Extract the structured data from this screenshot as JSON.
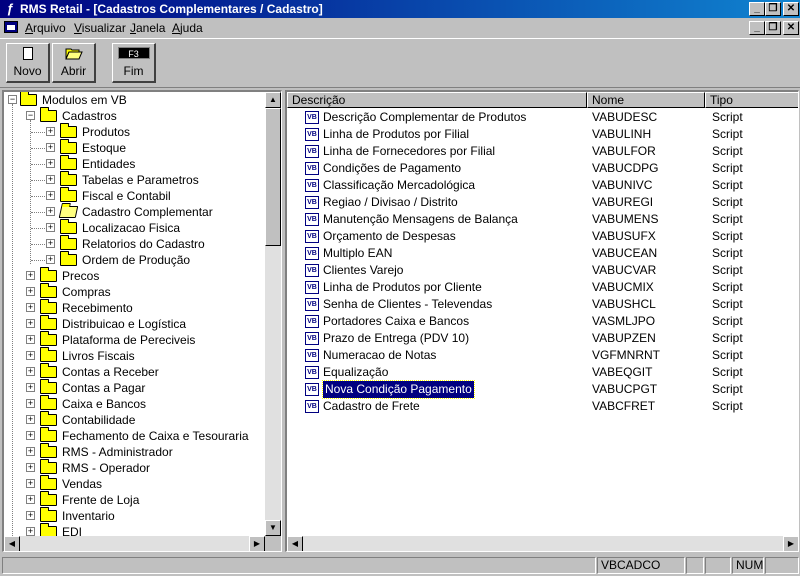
{
  "window": {
    "title": "RMS Retail - [Cadastros Complementares / Cadastro]"
  },
  "menu": [
    "Arquivo",
    "Visualizar",
    "Janela",
    "Ajuda"
  ],
  "toolbar": {
    "novo": "Novo",
    "abrir": "Abrir",
    "fim": "Fim",
    "fim_key": "F3"
  },
  "tree": {
    "root": "Modulos em VB",
    "cadastros": "Cadastros",
    "cadastros_children": [
      "Produtos",
      "Estoque",
      "Entidades",
      "Tabelas e Parametros",
      "Fiscal e Contabil",
      "Cadastro Complementar",
      "Localizacao Fisica",
      "Relatorios do Cadastro",
      "Ordem de Produção"
    ],
    "modules": [
      "Precos",
      "Compras",
      "Recebimento",
      "Distribuicao e Logística",
      "Plataforma de Pereciveis",
      "Livros Fiscais",
      "Contas a Receber",
      "Contas a Pagar",
      "Caixa e Bancos",
      "Contabilidade",
      "Fechamento de Caixa e Tesouraria",
      "RMS - Administrador",
      "RMS - Operador",
      "Vendas",
      "Frente de Loja",
      "Inventario",
      "EDI"
    ]
  },
  "list": {
    "columns": [
      "Descrição",
      "Nome",
      "Tipo"
    ],
    "rows": [
      [
        "Descrição Complementar de Produtos",
        "VABUDESC",
        "Script"
      ],
      [
        "Linha de Produtos por Filial",
        "VABULINH",
        "Script"
      ],
      [
        "Linha de Fornecedores por Filial",
        "VABULFOR",
        "Script"
      ],
      [
        "Condições de Pagamento",
        "VABUCDPG",
        "Script"
      ],
      [
        "Classificação Mercadológica",
        "VABUNIVC",
        "Script"
      ],
      [
        "Regiao / Divisao / Distrito",
        "VABUREGI",
        "Script"
      ],
      [
        "Manutenção Mensagens de Balança",
        "VABUMENS",
        "Script"
      ],
      [
        "Orçamento de Despesas",
        "VABUSUFX",
        "Script"
      ],
      [
        "Multiplo EAN",
        "VABUCEAN",
        "Script"
      ],
      [
        "Clientes Varejo",
        "VABUCVAR",
        "Script"
      ],
      [
        "Linha de Produtos por Cliente",
        "VABUCMIX",
        "Script"
      ],
      [
        "Senha de Clientes - Televendas",
        "VABUSHCL",
        "Script"
      ],
      [
        "Portadores Caixa e Bancos",
        "VASMLJPO",
        "Script"
      ],
      [
        "Prazo de Entrega (PDV 10)",
        "VABUPZEN",
        "Script"
      ],
      [
        "Numeracao de Notas",
        "VGFMNRNT",
        "Script"
      ],
      [
        "Equalização",
        "VABEQGIT",
        "Script"
      ],
      [
        "Nova Condição Pagamento",
        "VABUCPGT",
        "Script"
      ],
      [
        "Cadastro de Frete",
        "VABCFRET",
        "Script"
      ]
    ],
    "selected_index": 16
  },
  "status": {
    "program": "VBCADCO",
    "num": "NUM"
  }
}
